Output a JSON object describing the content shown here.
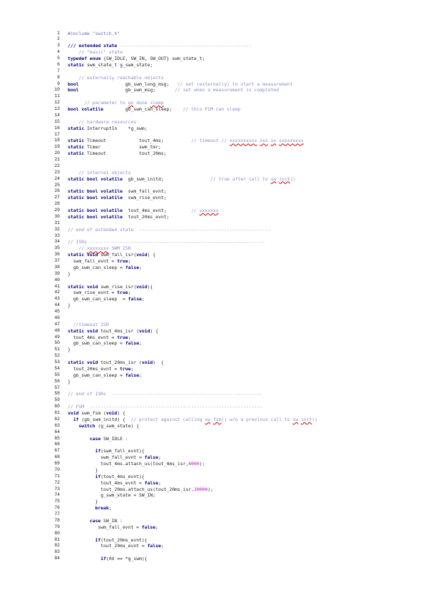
{
  "document": {
    "lines": [
      [
        {
          "t": "#include \"switch.h\"",
          "c": "st"
        }
      ],
      [],
      [
        {
          "t": "/// extended state ",
          "c": "kw"
        },
        {
          "t": "------------------------------------------------",
          "c": "cm"
        }
      ],
      [
        {
          "t": "    // \"basic\" state",
          "c": "cm"
        }
      ],
      [
        {
          "t": "typedef enum",
          "c": "kw"
        },
        {
          "t": " {SW_IDLE, SW_IN, SW_OUT} swm_state_t;",
          "c": "ty"
        }
      ],
      [
        {
          "t": "static",
          "c": "kw"
        },
        {
          "t": " swm_state_t g_swm_state;",
          "c": "ty"
        }
      ],
      [],
      [
        {
          "t": "    // externally reachable objects",
          "c": "cm"
        }
      ],
      [
        {
          "t": "bool",
          "c": "kw"
        },
        {
          "t": "                 gb_swm_long_msg;   ",
          "c": "ty"
        },
        {
          "t": "// set (externally) to start a measurement",
          "c": "cm"
        }
      ],
      [
        {
          "t": "bool",
          "c": "kw"
        },
        {
          "t": "                 gb_swm_msg;       ",
          "c": "ty"
        },
        {
          "t": "// set when a measurement is completed",
          "c": "cm"
        }
      ],
      [],
      [
        {
          "t": "      // parameter to ",
          "c": "cm"
        },
        {
          "t": "go",
          "c": "cm sq"
        },
        {
          "t": " done ",
          "c": "cm"
        },
        {
          "t": "sleep",
          "c": "cm sq"
        }
      ],
      [
        {
          "t": "bool volatile",
          "c": "kw"
        },
        {
          "t": "        gb_swm_can_sleep;    ",
          "c": "ty"
        },
        {
          "t": "// this FSM can sleep",
          "c": "cm"
        }
      ],
      [],
      [
        {
          "t": "    // hardware resources",
          "c": "cm"
        }
      ],
      [
        {
          "t": "static",
          "c": "kw"
        },
        {
          "t": " InterruptIn    *g_swm;",
          "c": "ty"
        }
      ],
      [],
      [
        {
          "t": "static",
          "c": "kw"
        },
        {
          "t": " Timeout            tout_4ms;          ",
          "c": "ty"
        },
        {
          "t": "// timeout // ",
          "c": "cm"
        },
        {
          "t": "xxxxxxxxxx",
          "c": "cm sq"
        },
        {
          "t": " ",
          "c": "cm"
        },
        {
          "t": "xxx",
          "c": "cm sq"
        },
        {
          "t": " ",
          "c": "cm"
        },
        {
          "t": "xx",
          "c": "cm sq"
        },
        {
          "t": " ",
          "c": "cm"
        },
        {
          "t": "xxxxxxxxx",
          "c": "cm sq"
        }
      ],
      [
        {
          "t": "static",
          "c": "kw"
        },
        {
          "t": " Timer              swm_tmr;",
          "c": "ty"
        }
      ],
      [
        {
          "t": "static",
          "c": "kw"
        },
        {
          "t": " Timeout            tout_20ms;",
          "c": "ty"
        }
      ],
      [],
      [],
      [
        {
          "t": "    // internal objects",
          "c": "cm"
        }
      ],
      [
        {
          "t": "static bool volatile",
          "c": "kw"
        },
        {
          "t": "  gb_swm_initd;                 ",
          "c": "ty"
        },
        {
          "t": "// true after call to ",
          "c": "cm"
        },
        {
          "t": "sw",
          "c": "cm sq"
        },
        {
          "t": "_",
          "c": "cm"
        },
        {
          "t": "init",
          "c": "cm sq"
        },
        {
          "t": "()",
          "c": "cm"
        }
      ],
      [],
      [
        {
          "t": "static bool volatile",
          "c": "kw"
        },
        {
          "t": "  swm_fall_evnt;",
          "c": "ty"
        }
      ],
      [
        {
          "t": "static bool volatile",
          "c": "kw"
        },
        {
          "t": "  swm_rise_evnt;",
          "c": "ty"
        }
      ],
      [],
      [
        {
          "t": "static bool volatile",
          "c": "kw"
        },
        {
          "t": "  tout_4ms_evnt;         ",
          "c": "ty"
        },
        {
          "t": "// ",
          "c": "cm"
        },
        {
          "t": "xxxxxxx",
          "c": "cm sq"
        }
      ],
      [
        {
          "t": "static bool volatile",
          "c": "kw"
        },
        {
          "t": "  tout_20ms_evnt;",
          "c": "ty"
        }
      ],
      [],
      [
        {
          "t": "// end of extended state  ------------------------------------------------",
          "c": "cm"
        }
      ],
      [],
      [
        {
          "t": "// ISRs ----------------------------------------------------------------",
          "c": "cm"
        }
      ],
      [
        {
          "t": "    // ",
          "c": "cm"
        },
        {
          "t": "xxxxxxxx",
          "c": "cm sq"
        },
        {
          "t": " SWM ISR",
          "c": "cm"
        }
      ],
      [
        {
          "t": "static void",
          "c": "kw"
        },
        {
          "t": " swm_fall_isr(",
          "c": "ty"
        },
        {
          "t": "void",
          "c": "kw"
        },
        {
          "t": ") {",
          "c": "ty"
        }
      ],
      [
        {
          "t": "  swm_fall_evnt = ",
          "c": "ty"
        },
        {
          "t": "true",
          "c": "kw"
        },
        {
          "t": ";",
          "c": "ty"
        }
      ],
      [
        {
          "t": "  gb_swm_can_sleep = ",
          "c": "ty"
        },
        {
          "t": "false",
          "c": "kw"
        },
        {
          "t": ";",
          "c": "ty"
        }
      ],
      [
        {
          "t": "}",
          "c": "ty"
        }
      ],
      [],
      [
        {
          "t": "static void",
          "c": "kw"
        },
        {
          "t": " swm_rise_isr(",
          "c": "ty"
        },
        {
          "t": "void",
          "c": "kw"
        },
        {
          "t": "){",
          "c": "ty"
        }
      ],
      [
        {
          "t": "  swm_rise_evnt = ",
          "c": "ty"
        },
        {
          "t": "true",
          "c": "kw"
        },
        {
          "t": ";",
          "c": "ty"
        }
      ],
      [
        {
          "t": "  gb_swm_can_sleep  = ",
          "c": "ty"
        },
        {
          "t": "false",
          "c": "kw"
        },
        {
          "t": ";",
          "c": "ty"
        }
      ],
      [
        {
          "t": "}",
          "c": "ty"
        }
      ],
      [],
      [],
      [
        {
          "t": "  //timeout ISR",
          "c": "cm"
        }
      ],
      [
        {
          "t": "static void",
          "c": "kw"
        },
        {
          "t": " tout_4ms_isr (",
          "c": "ty"
        },
        {
          "t": "void",
          "c": "kw"
        },
        {
          "t": ") {",
          "c": "ty"
        }
      ],
      [
        {
          "t": "  tout_4ms_evnt = ",
          "c": "ty"
        },
        {
          "t": "true",
          "c": "kw"
        },
        {
          "t": ";",
          "c": "ty"
        }
      ],
      [
        {
          "t": "  gb_swm_can_sleep = ",
          "c": "ty"
        },
        {
          "t": "false",
          "c": "kw"
        },
        {
          "t": ";",
          "c": "ty"
        }
      ],
      [
        {
          "t": "}",
          "c": "ty"
        }
      ],
      [],
      [
        {
          "t": "static void",
          "c": "kw"
        },
        {
          "t": " tout_20ms_isr (",
          "c": "ty"
        },
        {
          "t": "void",
          "c": "kw"
        },
        {
          "t": ")  {",
          "c": "ty"
        }
      ],
      [
        {
          "t": "  tout_20ms_evnt = ",
          "c": "ty"
        },
        {
          "t": "true",
          "c": "kw"
        },
        {
          "t": ";",
          "c": "ty"
        }
      ],
      [
        {
          "t": "  gb_swm_can_sleep = ",
          "c": "ty"
        },
        {
          "t": "false",
          "c": "kw"
        },
        {
          "t": ";",
          "c": "ty"
        }
      ],
      [
        {
          "t": "}",
          "c": "ty"
        }
      ],
      [],
      [
        {
          "t": "// end of ISRs  -------------------------------------------------------",
          "c": "cm"
        }
      ],
      [],
      [
        {
          "t": "// FSM  ---------------------------------------------------------------",
          "c": "cm"
        }
      ],
      [
        {
          "t": "void",
          "c": "kw"
        },
        {
          "t": " swm_fsm (",
          "c": "ty"
        },
        {
          "t": "void",
          "c": "kw"
        },
        {
          "t": ") {",
          "c": "ty"
        }
      ],
      [
        {
          "t": "  ",
          "c": "ty"
        },
        {
          "t": "if",
          "c": "kw"
        },
        {
          "t": " (gb_swm_initd) {  ",
          "c": "ty"
        },
        {
          "t": "// protect against calling ",
          "c": "cm"
        },
        {
          "t": "sw",
          "c": "cm sq"
        },
        {
          "t": "_",
          "c": "cm"
        },
        {
          "t": "fsm",
          "c": "cm sq"
        },
        {
          "t": "() w/o a previous call to ",
          "c": "cm"
        },
        {
          "t": "sw",
          "c": "cm sq"
        },
        {
          "t": "_",
          "c": "cm"
        },
        {
          "t": "init",
          "c": "cm sq"
        },
        {
          "t": "()",
          "c": "cm"
        }
      ],
      [
        {
          "t": "    ",
          "c": "ty"
        },
        {
          "t": "switch",
          "c": "kw"
        },
        {
          "t": " (g_swm_state) {",
          "c": "ty"
        }
      ],
      [],
      [
        {
          "t": "        ",
          "c": "ty"
        },
        {
          "t": "case",
          "c": "kw"
        },
        {
          "t": " SW_IDLE :",
          "c": "ty"
        }
      ],
      [],
      [
        {
          "t": "          ",
          "c": "ty"
        },
        {
          "t": "if",
          "c": "kw"
        },
        {
          "t": "(swm_fall_evnt){",
          "c": "ty"
        }
      ],
      [
        {
          "t": "            swm_fall_evnt = ",
          "c": "ty"
        },
        {
          "t": "false",
          "c": "kw"
        },
        {
          "t": ";",
          "c": "ty"
        }
      ],
      [
        {
          "t": "            tout_4ms.attach_us(tout_4ms_isr,",
          "c": "ty"
        },
        {
          "t": "4000",
          "c": "num"
        },
        {
          "t": ");",
          "c": "ty"
        }
      ],
      [
        {
          "t": "          }",
          "c": "ty"
        }
      ],
      [
        {
          "t": "          ",
          "c": "ty"
        },
        {
          "t": "if",
          "c": "kw"
        },
        {
          "t": "(tout_4ms_evnt){",
          "c": "ty"
        }
      ],
      [
        {
          "t": "            tout_4ms_evnt = ",
          "c": "ty"
        },
        {
          "t": "false",
          "c": "kw"
        },
        {
          "t": ";",
          "c": "ty"
        }
      ],
      [
        {
          "t": "            tout_20ms.attach_us(tout_20ms_isr,",
          "c": "ty"
        },
        {
          "t": "20000",
          "c": "num"
        },
        {
          "t": ");",
          "c": "ty"
        }
      ],
      [
        {
          "t": "            g_swm_state = SW_IN;",
          "c": "ty"
        }
      ],
      [
        {
          "t": "          }",
          "c": "ty"
        }
      ],
      [
        {
          "t": "          ",
          "c": "ty"
        },
        {
          "t": "break",
          "c": "kw"
        },
        {
          "t": ";",
          "c": "ty"
        }
      ],
      [],
      [
        {
          "t": "        ",
          "c": "ty"
        },
        {
          "t": "case",
          "c": "kw"
        },
        {
          "t": " SW_IN :",
          "c": "ty"
        }
      ],
      [
        {
          "t": "           swm_fall_evnt = ",
          "c": "ty"
        },
        {
          "t": "false",
          "c": "kw"
        },
        {
          "t": ";",
          "c": "ty"
        }
      ],
      [],
      [
        {
          "t": "          ",
          "c": "ty"
        },
        {
          "t": "if",
          "c": "kw"
        },
        {
          "t": "(tout_20ms_evnt){",
          "c": "ty"
        }
      ],
      [
        {
          "t": "            tout_20ms_evnt = ",
          "c": "ty"
        },
        {
          "t": "false",
          "c": "kw"
        },
        {
          "t": ";",
          "c": "ty"
        }
      ],
      [],
      [
        {
          "t": "            ",
          "c": "ty"
        },
        {
          "t": "if",
          "c": "kw"
        },
        {
          "t": "(0U == *g_swm){",
          "c": "ty"
        }
      ]
    ]
  }
}
